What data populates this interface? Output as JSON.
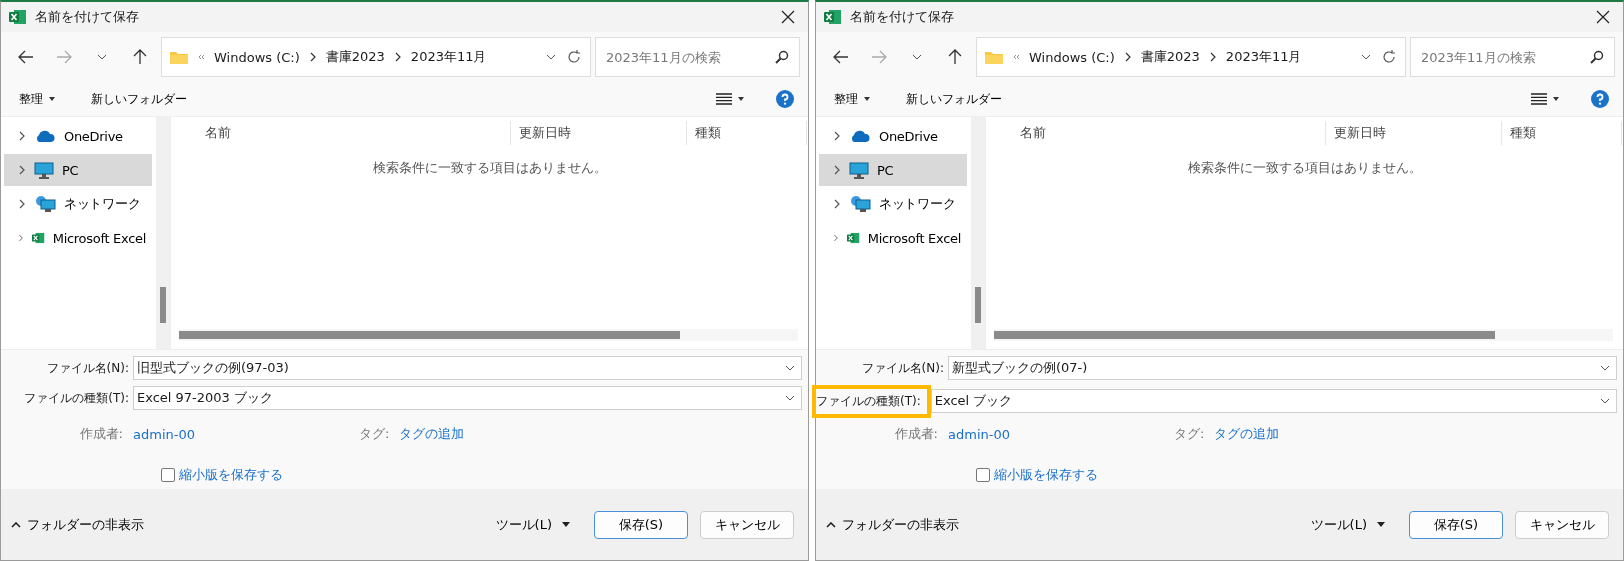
{
  "dialogs": [
    {
      "title": "名前を付けて保存",
      "breadcrumb": [
        "Windows (C:)",
        "書庫2023",
        "2023年11月"
      ],
      "search_placeholder": "2023年11月の検索",
      "organize": "整理",
      "new_folder": "新しいフォルダー",
      "sidebar": [
        {
          "label": "OneDrive",
          "kind": "cloud",
          "selected": false
        },
        {
          "label": "PC",
          "kind": "pc",
          "selected": true
        },
        {
          "label": "ネットワーク",
          "kind": "network",
          "selected": false
        },
        {
          "label": "Microsoft Excel",
          "kind": "excel",
          "selected": false
        }
      ],
      "columns": [
        "名前",
        "更新日時",
        "種類"
      ],
      "empty_message": "検索条件に一致する項目はありません。",
      "file_name_label": "ファイル名(N):",
      "file_name": "旧型式ブックの例(97-03)",
      "file_type_label": "ファイルの種類(T):",
      "file_type": "Excel 97-2003 ブック",
      "file_type_highlighted": false,
      "author_label": "作成者:",
      "author": "admin-00",
      "tag_label": "タグ:",
      "tag": "タグの追加",
      "thumbnail": {
        "label": "縮小版を保存する",
        "checked": false
      },
      "hide_folders": "フォルダーの非表示",
      "tools": "ツール(L)",
      "save": "保存(S)",
      "cancel": "キャンセル"
    },
    {
      "title": "名前を付けて保存",
      "breadcrumb": [
        "Windows (C:)",
        "書庫2023",
        "2023年11月"
      ],
      "search_placeholder": "2023年11月の検索",
      "organize": "整理",
      "new_folder": "新しいフォルダー",
      "sidebar": [
        {
          "label": "OneDrive",
          "kind": "cloud",
          "selected": false
        },
        {
          "label": "PC",
          "kind": "pc",
          "selected": true
        },
        {
          "label": "ネットワーク",
          "kind": "network",
          "selected": false
        },
        {
          "label": "Microsoft Excel",
          "kind": "excel",
          "selected": false
        }
      ],
      "columns": [
        "名前",
        "更新日時",
        "種類"
      ],
      "empty_message": "検索条件に一致する項目はありません。",
      "file_name_label": "ファイル名(N):",
      "file_name": "新型式ブックの例(07-)",
      "file_type_label": "ファイルの種類(T):",
      "file_type": "Excel ブック",
      "file_type_highlighted": true,
      "author_label": "作成者:",
      "author": "admin-00",
      "tag_label": "タグ:",
      "tag": "タグの追加",
      "thumbnail": {
        "label": "縮小版を保存する",
        "checked": false
      },
      "hide_folders": "フォルダーの非表示",
      "tools": "ツール(L)",
      "save": "保存(S)",
      "cancel": "キャンセル"
    }
  ]
}
